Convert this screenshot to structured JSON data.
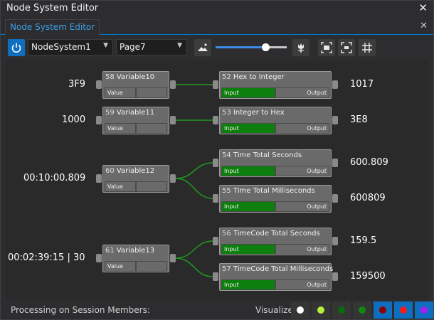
{
  "window": {
    "title": "Node System Editor",
    "close_glyph": "✕"
  },
  "tab": {
    "label": "Node System Editor",
    "close_glyph": "✕"
  },
  "toolbar": {
    "system": "NodeSystem1",
    "page": "Page7",
    "zoom_fraction": 0.7,
    "accent": "#0e6fc1"
  },
  "nodes": [
    {
      "id": "58",
      "name": "Variable10",
      "slots": [
        {
          "label": "Value",
          "style": "gray"
        },
        {
          "label": "",
          "style": "gray"
        }
      ],
      "in_value": "3F9"
    },
    {
      "id": "52",
      "name": "Hex to Integer",
      "slots": [
        {
          "label": "Input",
          "style": "green"
        },
        {
          "label": "Output",
          "style": "gray"
        }
      ],
      "out_value": "1017"
    },
    {
      "id": "59",
      "name": "Variable11",
      "slots": [
        {
          "label": "Value",
          "style": "gray"
        },
        {
          "label": "",
          "style": "gray"
        }
      ],
      "in_value": "1000"
    },
    {
      "id": "53",
      "name": "Integer to Hex",
      "slots": [
        {
          "label": "Input",
          "style": "green"
        },
        {
          "label": "Output",
          "style": "gray"
        }
      ],
      "out_value": "3E8"
    },
    {
      "id": "60",
      "name": "Variable12",
      "slots": [
        {
          "label": "Value",
          "style": "gray"
        },
        {
          "label": "",
          "style": "gray"
        }
      ],
      "in_value": "00:10:00.809"
    },
    {
      "id": "54",
      "name": "Time Total Seconds",
      "slots": [
        {
          "label": "Input",
          "style": "green"
        },
        {
          "label": "Output",
          "style": "gray"
        }
      ],
      "out_value": "600.809"
    },
    {
      "id": "55",
      "name": "Time Total Milliseconds",
      "slots": [
        {
          "label": "Input",
          "style": "green"
        },
        {
          "label": "Output",
          "style": "gray"
        }
      ],
      "out_value": "600809"
    },
    {
      "id": "61",
      "name": "Variable13",
      "slots": [
        {
          "label": "Value",
          "style": "gray"
        },
        {
          "label": "",
          "style": "gray"
        }
      ],
      "in_value": "00:02:39:15 | 30"
    },
    {
      "id": "56",
      "name": "TimeCode Total Seconds",
      "slots": [
        {
          "label": "Input",
          "style": "green"
        },
        {
          "label": "Output",
          "style": "gray"
        }
      ],
      "out_value": "159.5"
    },
    {
      "id": "57",
      "name": "TimeCode Total Milliseconds",
      "slots": [
        {
          "label": "Input",
          "style": "green"
        },
        {
          "label": "Output",
          "style": "gray"
        }
      ],
      "out_value": "159500"
    }
  ],
  "status": {
    "processing_label": "Processing on Session Members:",
    "visualize_label": "Visualize:",
    "visualize_colors": [
      "#ffffff",
      "#b7f03a",
      "#0c6b0c",
      "#0f8a0f",
      "#8b0000",
      "#ff1a1a",
      "#a020f0"
    ],
    "visualize_selected": [
      4,
      5,
      6
    ]
  }
}
